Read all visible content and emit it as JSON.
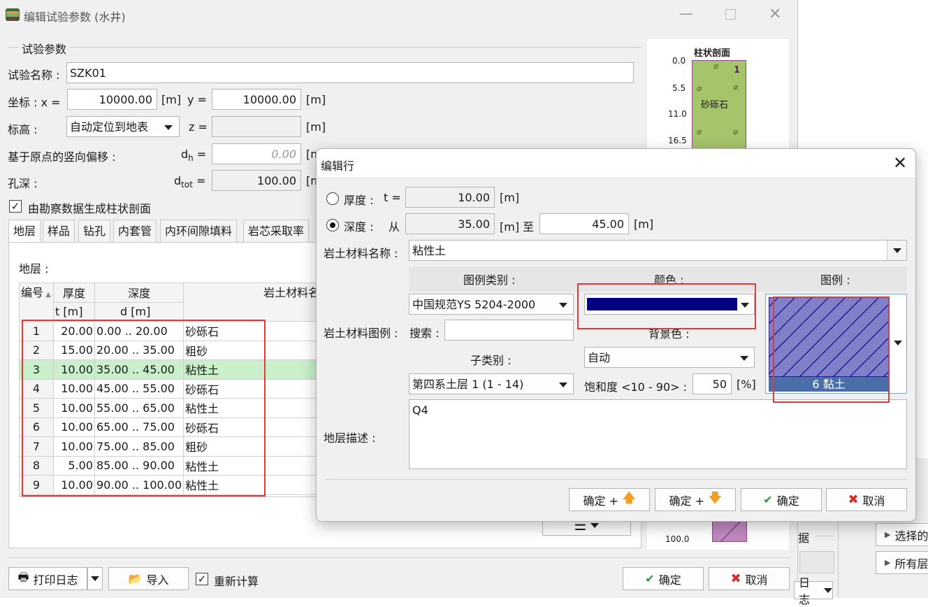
{
  "main_window": {
    "title": "编辑试验参数 (水井)",
    "section_title": "试验参数",
    "test_name_label": "试验名称 :",
    "test_name_value": "SZK01",
    "coord_label": "坐标 : x =",
    "x_value": "10000.00",
    "unit_m": "[m]",
    "y_label": "y =",
    "y_value": "10000.00",
    "elevation_label": "标高 :",
    "elevation_select": "自动定位到地表",
    "z_label": "z =",
    "offset_label": "基于原点的竖向偏移 :",
    "dh_label": "d",
    "dh_sub": "h",
    "dh_eq": " =",
    "dh_value": "0.00",
    "depth_label": "孔深 :",
    "dtot_label": "d",
    "dtot_sub": "tot",
    "dtot_eq": " =",
    "dtot_value": "100.00",
    "generate_profile_label": "由勘察数据生成柱状剖面",
    "tabs": [
      "地层",
      "样品",
      "钻孔",
      "内套管",
      "内环间隙填料",
      "岩芯采取率"
    ],
    "layers_label": "地层 :",
    "table_headers": {
      "no": "编号",
      "thickness": "厚度",
      "thickness_unit": "t [m]",
      "depth": "深度",
      "depth_unit": "d [m]",
      "material": "岩土材料名称"
    },
    "rows": [
      {
        "no": "1",
        "t": "20.00",
        "d": "0.00 .. 20.00",
        "name": "砂砾石"
      },
      {
        "no": "2",
        "t": "15.00",
        "d": "20.00 .. 35.00",
        "name": "粗砂"
      },
      {
        "no": "3",
        "t": "10.00",
        "d": "35.00 .. 45.00",
        "name": "粘性土"
      },
      {
        "no": "4",
        "t": "10.00",
        "d": "45.00 .. 55.00",
        "name": "砂砾石"
      },
      {
        "no": "5",
        "t": "10.00",
        "d": "55.00 .. 65.00",
        "name": "粘性土"
      },
      {
        "no": "6",
        "t": "10.00",
        "d": "65.00 .. 75.00",
        "name": "砂砾石"
      },
      {
        "no": "7",
        "t": "10.00",
        "d": "75.00 .. 85.00",
        "name": "粗砂"
      },
      {
        "no": "8",
        "t": "5.00",
        "d": "85.00 .. 90.00",
        "name": "粘性土"
      },
      {
        "no": "9",
        "t": "10.00",
        "d": "90.00 .. 100.00",
        "name": "粘性土"
      }
    ],
    "selected_row": 2,
    "print_log": "打印日志",
    "import": "导入",
    "recalc": "重新计算",
    "ok": "确定",
    "cancel": "取消"
  },
  "profile": {
    "title": "柱状剖面",
    "ticks": [
      "0.0",
      "5.5",
      "11.0",
      "16.5"
    ],
    "bottom_tick": "100.0",
    "layer_label": "砂砾石",
    "layer_number": "1"
  },
  "background_window": {
    "fragment_ju": "据",
    "select_label": "选择的",
    "all_label": "所有层",
    "log_fragment": "日志"
  },
  "dialog": {
    "title": "编辑行",
    "thickness_label": "厚度 :",
    "t_label": "t =",
    "t_value": "10.00",
    "depth_label": "深度 :",
    "from_label": "从",
    "from_value": "35.00",
    "to_label": "[m] 至",
    "to_value": "45.00",
    "unit_m": "[m]",
    "material_name_label": "岩土材料名称 :",
    "material_name_value": "粘性土",
    "legend_type_label": "图例类别 :",
    "color_label": "颜色 :",
    "pattern_label": "图例 :",
    "legend_type_value": "中国规范YS 5204-2000",
    "color_value": "#000080",
    "material_legend_label": "岩土材料图例 :",
    "search_label": "搜索 :",
    "search_value": "",
    "bg_color_label": "背景色 :",
    "subcategory_label": "子类别 :",
    "bg_color_value": "自动",
    "subcategory_value": "第四系土层 1 (1 - 14)",
    "saturation_label": "饱和度 <10 - 90> :",
    "saturation_value": "50",
    "percent_unit": "[%]",
    "pattern_name": "6 黏土",
    "description_label": "地层描述 :",
    "description_value": "Q4",
    "ok_up": "确定 +",
    "ok_down": "确定 +",
    "ok": "确定",
    "cancel": "取消"
  },
  "colors": {
    "ok_green": "#2e9b3a",
    "cancel_red": "#d32f2f",
    "arrow_orange": "#f0a020",
    "highlight_row": "#c9f0cb",
    "profile_gravel": "#a6c46a",
    "clay_pattern": "#8080c8",
    "pattern_label_bg": "#4a6fa8",
    "annotation_red": "#e53935"
  }
}
